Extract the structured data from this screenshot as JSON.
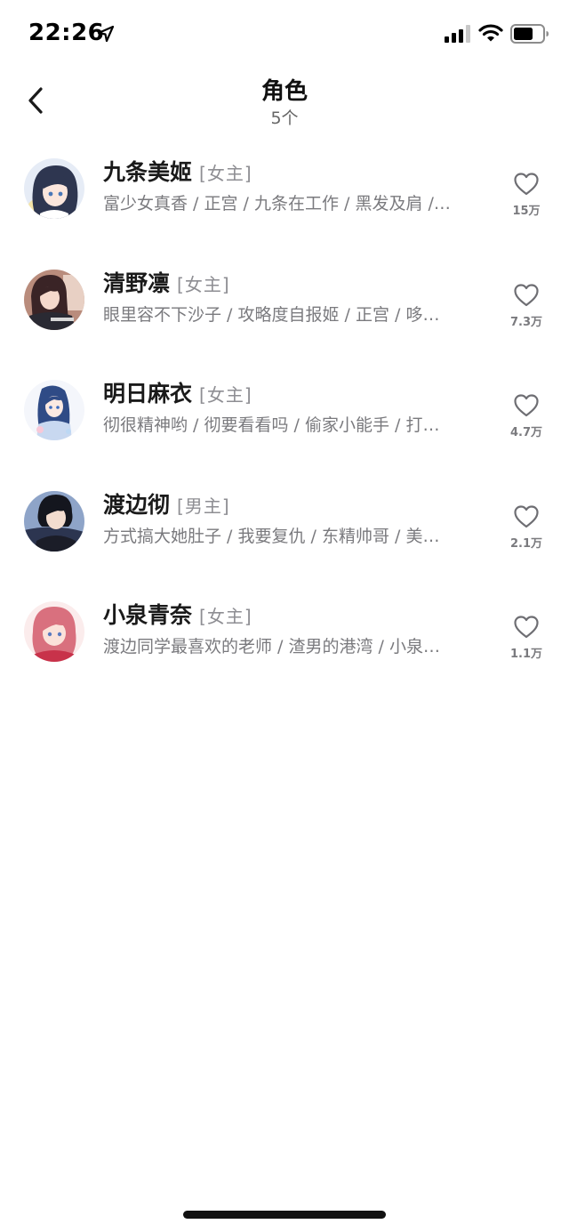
{
  "status_bar": {
    "time": "22:26",
    "location_icon": "location-arrow-icon",
    "signal_icon": "cellular-signal-icon",
    "wifi_icon": "wifi-icon",
    "battery_icon": "battery-icon"
  },
  "nav": {
    "back_icon": "chevron-left-icon",
    "title": "角色",
    "subtitle": "5个"
  },
  "characters": [
    {
      "name": "九条美姬",
      "role": "[女主]",
      "tags": "富少女真香 / 正宫 / 九条在工作 / 黑发及肩 /…",
      "likes": "15万",
      "avatar_color": "#3a4a6e"
    },
    {
      "name": "清野凛",
      "role": "[女主]",
      "tags": "眼里容不下沙子 / 攻略度自报姬 / 正宫 / 哆…",
      "likes": "7.3万",
      "avatar_color": "#5a3a3a"
    },
    {
      "name": "明日麻衣",
      "role": "[女主]",
      "tags": "彻很精神哟 / 彻要看看吗 / 偷家小能手 / 打…",
      "likes": "4.7万",
      "avatar_color": "#3a5a8e"
    },
    {
      "name": "渡边彻",
      "role": "[男主]",
      "tags": "方式搞大她肚子 / 我要复仇 / 东精帅哥 / 美…",
      "likes": "2.1万",
      "avatar_color": "#1e2233"
    },
    {
      "name": "小泉青奈",
      "role": "[女主]",
      "tags": "渡边同学最喜欢的老师 / 渣男的港湾 / 小泉…",
      "likes": "1.1万",
      "avatar_color": "#d6707a"
    }
  ],
  "colors": {
    "text_primary": "#1a1a1a",
    "text_secondary": "#7a7a7e",
    "background": "#ffffff"
  }
}
